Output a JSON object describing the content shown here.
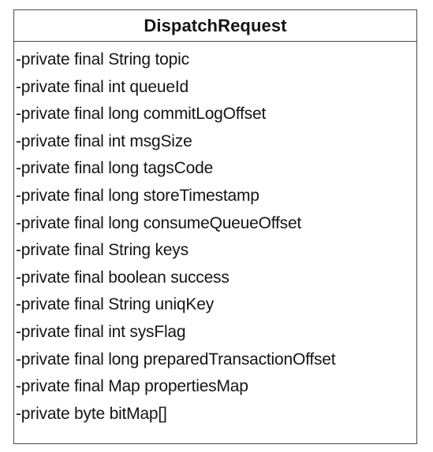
{
  "class_box": {
    "name": "DispatchRequest",
    "attributes": [
      "-private final String topic",
      "-private final int queueId",
      "-private final long commitLogOffset",
      "-private final int msgSize",
      "-private final long tagsCode",
      "-private final long storeTimestamp",
      "-private final long consumeQueueOffset",
      "-private final String keys",
      "-private final boolean success",
      "-private final String uniqKey",
      "-private final int sysFlag",
      "-private final long preparedTransactionOffset",
      "-private final Map propertiesMap",
      "-private byte bitMap[]"
    ]
  }
}
